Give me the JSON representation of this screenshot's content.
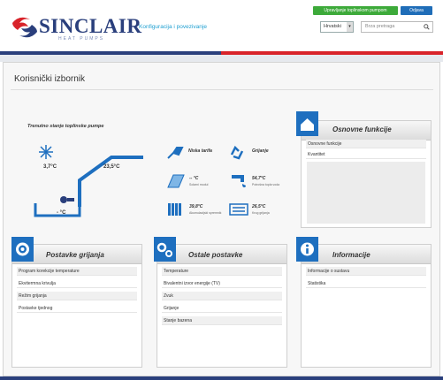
{
  "header": {
    "brand": "SINCLAIR",
    "brand_sub": "HEAT PUMPS",
    "link": "Konfiguracija i povezivanje",
    "btn_green": "Upravljanje toplinskom pumpom",
    "btn_blue": "Odjava",
    "language": "Hrvatski",
    "search_placeholder": "Brza pretraga"
  },
  "page": {
    "title": "Korisnički izbornik"
  },
  "status": {
    "title": "Trenutno stanje toplinske pumpe",
    "outdoor_temp": "3,7°C",
    "indoor_temp": "23,5°C",
    "floor_temp": "- °C",
    "tariff": "Niska tarifa",
    "mode": "Grijanje",
    "solar_value": "-- °C",
    "solar_label": "Solarni modul",
    "dhw_value": "54,7°C",
    "dhw_label": "Potrošna topla voda",
    "buffer_value": "39,8°C",
    "buffer_label": "Akumulacijski spremnik",
    "heating_value": "26,5°C",
    "heating_label": "Krug grijanja"
  },
  "cards": {
    "basic": {
      "title": "Osnovne funkcije",
      "items": [
        "Osnovne funkcije",
        "Kvantitet"
      ]
    },
    "heating": {
      "title": "Postavke grijanja",
      "items": [
        "Program korekcije temperature",
        "Ekvitermna krivulja",
        "Režim grijanja",
        "Postavke tjednog"
      ]
    },
    "other": {
      "title": "Ostale postavke",
      "items": [
        "Temperature",
        "Bivalentni izvor energije (TV)",
        "Zvuk",
        "Grijanje",
        "Stanje bazena"
      ]
    },
    "info": {
      "title": "Informacije",
      "items": [
        "Informacije o sustavu",
        "Statistika"
      ]
    }
  },
  "colors": {
    "brand_blue": "#2a3f7c",
    "accent_red": "#d8232a",
    "icon_blue": "#1e6fbf",
    "link_blue": "#1e9fd1",
    "green": "#3daa3a"
  }
}
